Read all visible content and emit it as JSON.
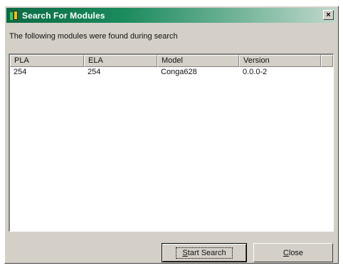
{
  "window": {
    "title": "Search For Modules",
    "close_glyph": "×",
    "icon": "app-module-icon"
  },
  "intro_text": "The following modules were found during search",
  "table": {
    "columns": [
      "PLA",
      "ELA",
      "Model",
      "Version"
    ],
    "rows": [
      [
        "254",
        "254",
        "Conga628",
        "0.0.0-2"
      ]
    ]
  },
  "buttons": {
    "start_search": {
      "prefix": "",
      "mnemonic": "S",
      "rest": "tart Search"
    },
    "close": {
      "prefix": "",
      "mnemonic": "C",
      "rest": "lose"
    }
  },
  "colors": {
    "titlebar_start": "#0a6a44",
    "titlebar_end": "#bfd8cc",
    "dialog_face": "#d4d0c8"
  }
}
